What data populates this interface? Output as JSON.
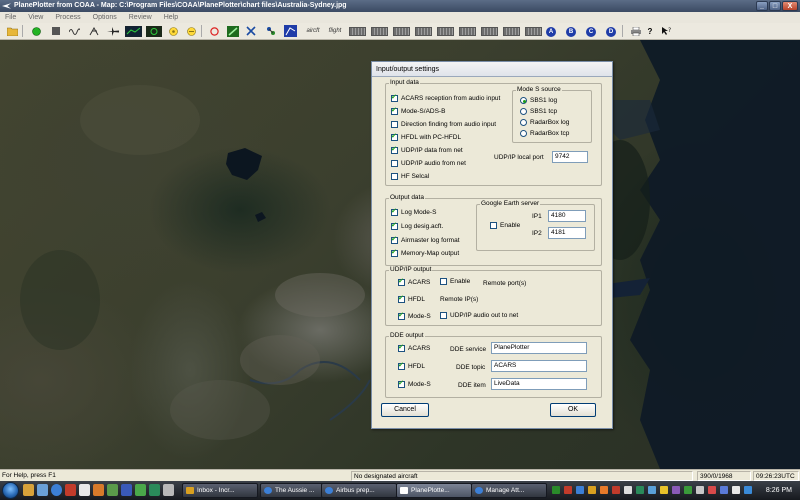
{
  "window": {
    "title": "PlanePlotter from COAA - Map: C:\\Program Files\\COAA\\PlanePlotter\\chart files\\Australia-Sydney.jpg",
    "controls": [
      "_",
      "□",
      "X"
    ]
  },
  "menu": [
    "File",
    "View",
    "Process",
    "Options",
    "Review",
    "Help"
  ],
  "toolbar": {
    "aircraft_label": "aircft",
    "flight_label": "flight",
    "lettered_buttons": [
      "A",
      "B",
      "C",
      "D"
    ],
    "help_label": "?"
  },
  "dialog": {
    "title": "Input/output settings",
    "input_data": {
      "label": "Input data",
      "items": [
        {
          "label": "ACARS reception from audio input",
          "checked": true
        },
        {
          "label": "Mode-S/ADS-B",
          "checked": true
        },
        {
          "label": "Direction finding from audio input",
          "checked": false
        },
        {
          "label": "HFDL with PC-HFDL",
          "checked": true
        },
        {
          "label": "UDP/IP data from net",
          "checked": true
        },
        {
          "label": "UDP/IP audio from net",
          "checked": false
        },
        {
          "label": "HF Selcal",
          "checked": false
        }
      ],
      "mode_s_source": {
        "label": "Mode S source",
        "options": [
          {
            "label": "SBS1 log",
            "selected": true
          },
          {
            "label": "SBS1 tcp",
            "selected": false
          },
          {
            "label": "RadarBox log",
            "selected": false
          },
          {
            "label": "RadarBox tcp",
            "selected": false
          }
        ]
      },
      "udp_local_port_label": "UDP/IP local port",
      "udp_local_port": "9742"
    },
    "output_data": {
      "label": "Output data",
      "items": [
        {
          "label": "Log Mode-S",
          "checked": true
        },
        {
          "label": "Log desig.acft.",
          "checked": true
        },
        {
          "label": "Airmaster log format",
          "checked": true
        },
        {
          "label": "Memory-Map output",
          "checked": true
        }
      ],
      "google_earth": {
        "label": "Google Earth server",
        "enable_label": "Enable",
        "enabled": false,
        "ip1_label": "IP1",
        "ip1": "4180",
        "ip2_label": "IP2",
        "ip2": "4181"
      }
    },
    "udp_output": {
      "label": "UDP/IP output",
      "items": [
        {
          "label": "ACARS",
          "checked": true
        },
        {
          "label": "HFDL",
          "checked": true
        },
        {
          "label": "Mode-S",
          "checked": true
        }
      ],
      "enable_label": "Enable",
      "enabled": false,
      "remote_ports_label": "Remote port(s)",
      "remote_ips_label": "Remote IP(s)",
      "audio_out_label": "UDP/IP audio out to net",
      "audio_out": false
    },
    "dde_output": {
      "label": "DDE output",
      "items": [
        {
          "label": "ACARS",
          "checked": true,
          "field_label": "DDE service",
          "value": "PlanePlotter"
        },
        {
          "label": "HFDL",
          "checked": true,
          "field_label": "DDE topic",
          "value": "ACARS"
        },
        {
          "label": "Mode-S",
          "checked": true,
          "field_label": "DDE item",
          "value": "LiveData"
        }
      ]
    },
    "cancel_label": "Cancel",
    "ok_label": "OK"
  },
  "statusbar": {
    "help": "For Help, press F1",
    "aircraft": "No designated aircraft",
    "coords": "390/0/1968",
    "time": "09:26:23UTC"
  },
  "taskbar": {
    "tasks": [
      {
        "label": "Inbox - Incr...",
        "color": "#d9a020"
      },
      {
        "label": "The Aussie ...",
        "color": "#3c7fd6"
      },
      {
        "label": "Airbus prep...",
        "color": "#3c7fd6"
      },
      {
        "label": "PlanePlotte...",
        "color": "#ffffff",
        "active": true
      },
      {
        "label": "Manage Att...",
        "color": "#3c7fd6"
      }
    ],
    "clock": "8:26 PM"
  },
  "colors": {
    "map_water": "#0f1a26",
    "dialog_bg": "#ece9d8",
    "check_green": "#21a121"
  }
}
